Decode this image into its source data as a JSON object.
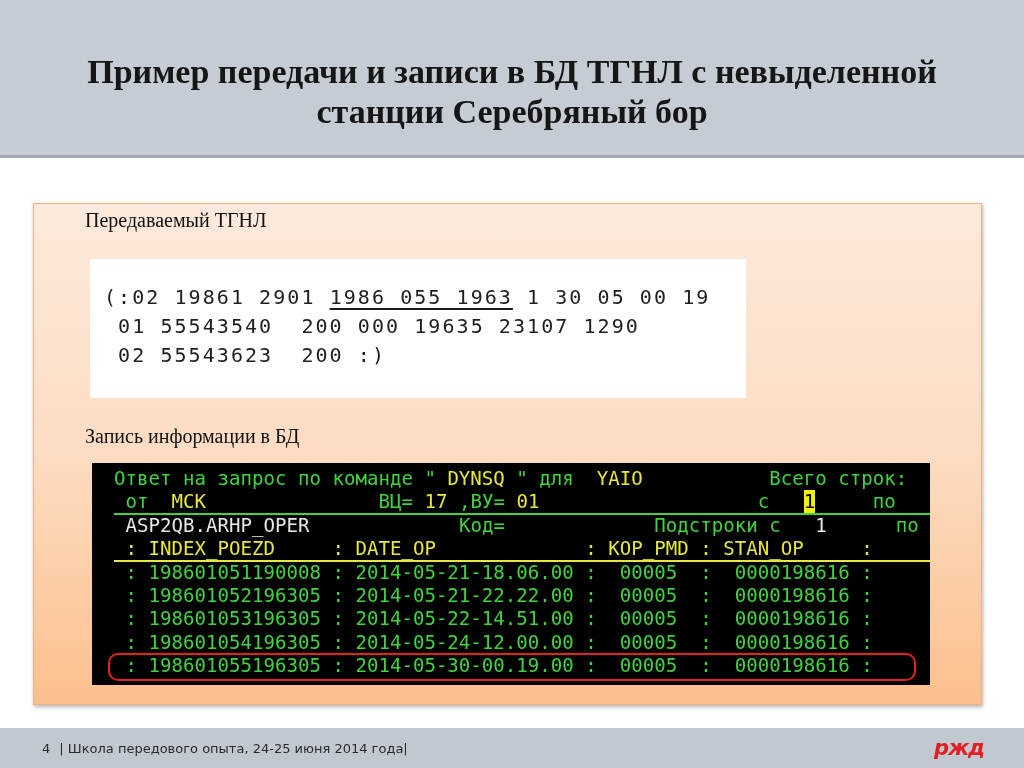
{
  "slide": {
    "title": "Пример передачи и записи в БД ТГНЛ с невыделенной станции Серебряный бор"
  },
  "telegram": {
    "heading": "Передаваемый ТГНЛ",
    "lines": [
      {
        "segments": [
          {
            "text": "(:02 19861 2901 ",
            "underlined": false
          },
          {
            "text": "1986 055 1963",
            "underlined": true
          },
          {
            "text": " 1 30 05 00 19",
            "underlined": false
          }
        ]
      },
      {
        "segments": [
          {
            "text": " 01 55543540  200 000 19635 23107 1290",
            "underlined": false
          }
        ]
      },
      {
        "segments": [
          {
            "text": " 02 55543623  200 :)",
            "underlined": false
          }
        ]
      }
    ]
  },
  "database": {
    "heading": "Запись информации в БД",
    "terminal": {
      "lines": [
        {
          "kind": "text",
          "outlined": false,
          "segments": [
            {
              "text": "Ответ на запрос по команде \" ",
              "color": "#3fd43f",
              "highlighted": false
            },
            {
              "text": "DYNSQ",
              "color": "#e8e83c",
              "highlighted": false
            },
            {
              "text": " \" для  ",
              "color": "#3fd43f",
              "highlighted": false
            },
            {
              "text": "YAIO",
              "color": "#e8e83c",
              "highlighted": false
            },
            {
              "text": "           Всего строк:",
              "color": "#3fd43f",
              "highlighted": false
            }
          ]
        },
        {
          "kind": "text",
          "outlined": false,
          "segments": [
            {
              "text": " от  ",
              "color": "#3fd43f",
              "highlighted": false
            },
            {
              "text": "МСК",
              "color": "#e8e83c",
              "highlighted": false
            },
            {
              "text": "               ВЦ= ",
              "color": "#3fd43f",
              "highlighted": false
            },
            {
              "text": "17",
              "color": "#e8e83c",
              "highlighted": false
            },
            {
              "text": " ,ВУ= ",
              "color": "#3fd43f",
              "highlighted": false
            },
            {
              "text": "01",
              "color": "#e8e83c",
              "highlighted": false
            },
            {
              "text": "                   с   ",
              "color": "#3fd43f",
              "highlighted": false
            },
            {
              "text": "1",
              "color": "#f2f200",
              "highlighted": true
            },
            {
              "text": "     по",
              "color": "#3fd43f",
              "highlighted": false
            }
          ]
        },
        {
          "kind": "rule",
          "color": "#3fd43f"
        },
        {
          "kind": "text",
          "outlined": false,
          "segments": [
            {
              "text": " ASP2QB.ARHP_OPER",
              "color": "#e8e8e8",
              "highlighted": false
            },
            {
              "text": "             Код=",
              "color": "#3fd43f",
              "highlighted": false
            },
            {
              "text": "             Подстроки с",
              "color": "#3fd43f",
              "highlighted": false
            },
            {
              "text": "   1",
              "color": "#e8e8e8",
              "highlighted": false
            },
            {
              "text": "      по",
              "color": "#3fd43f",
              "highlighted": false
            }
          ]
        },
        {
          "kind": "text",
          "outlined": false,
          "segments": [
            {
              "text": " : INDEX_POEZD     : DATE_OP             : KOP_PMD : STAN_OP     :",
              "color": "#e8e83c",
              "highlighted": false
            }
          ]
        },
        {
          "kind": "rule",
          "color": "#e8e83c"
        },
        {
          "kind": "text",
          "outlined": false,
          "segments": [
            {
              "text": " : 198601051190008 : 2014-05-21-18.06.00 :  00005  :  0000198616 :",
              "color": "#3fd43f",
              "highlighted": false
            }
          ]
        },
        {
          "kind": "text",
          "outlined": false,
          "segments": [
            {
              "text": " : 198601052196305 : 2014-05-21-22.22.00 :  00005  :  0000198616 :",
              "color": "#3fd43f",
              "highlighted": false
            }
          ]
        },
        {
          "kind": "text",
          "outlined": false,
          "segments": [
            {
              "text": " : 198601053196305 : 2014-05-22-14.51.00 :  00005  :  0000198616 :",
              "color": "#3fd43f",
              "highlighted": false
            }
          ]
        },
        {
          "kind": "text",
          "outlined": false,
          "segments": [
            {
              "text": " : 198601054196305 : 2014-05-24-12.00.00 :  00005  :  0000198616 :",
              "color": "#3fd43f",
              "highlighted": false
            }
          ]
        },
        {
          "kind": "text",
          "outlined": true,
          "segments": [
            {
              "text": " : 198601055196305 : 2014-05-30-00.19.00 :  00005  :  0000198616 :",
              "color": "#3fd43f",
              "highlighted": false
            }
          ]
        }
      ]
    }
  },
  "footer": {
    "page_number": "4",
    "text": "| Школа передового опыта, 24-25 июня 2014 года|",
    "logo": "ржд"
  }
}
